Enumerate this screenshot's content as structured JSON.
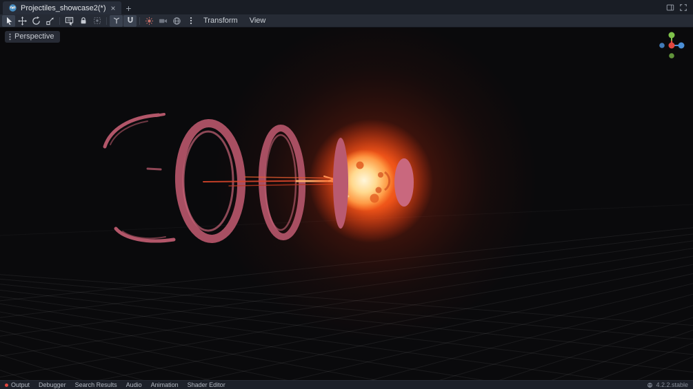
{
  "scene_tabs": {
    "active_tab": {
      "label": "Projectiles_showcase2(*)",
      "close_glyph": "×"
    },
    "add_label": "+"
  },
  "toolbar": {
    "transform_menu": "Transform",
    "view_menu": "View",
    "tools": [
      {
        "name": "select-mode",
        "active": true
      },
      {
        "name": "move-mode",
        "active": false
      },
      {
        "name": "rotate-mode",
        "active": false
      },
      {
        "name": "scale-mode",
        "active": false
      },
      {
        "name": "list-select-mode",
        "active": false
      },
      {
        "name": "lock-selected",
        "active": false
      },
      {
        "name": "group-selected",
        "active": false
      },
      {
        "name": "use-local-space",
        "active": true
      },
      {
        "name": "use-snap",
        "active": true
      },
      {
        "name": "preview-sunlight",
        "active": false
      },
      {
        "name": "camera-preview",
        "active": false
      },
      {
        "name": "preview-environment",
        "active": false
      },
      {
        "name": "more-options",
        "active": false
      }
    ]
  },
  "viewport": {
    "perspective_label": "Perspective"
  },
  "bottom_bar": {
    "items": [
      {
        "label": "Output",
        "has_error_dot": true
      },
      {
        "label": "Debugger"
      },
      {
        "label": "Search Results"
      },
      {
        "label": "Audio"
      },
      {
        "label": "Animation"
      },
      {
        "label": "Shader Editor"
      }
    ],
    "version": "4.2.2.stable"
  },
  "colors": {
    "godot_blue": "#478cbf",
    "ring_pink": "#b25669",
    "fire_core": "#fff3d0",
    "fire_orange": "#ff7a2a",
    "error_red": "#e0453e"
  }
}
